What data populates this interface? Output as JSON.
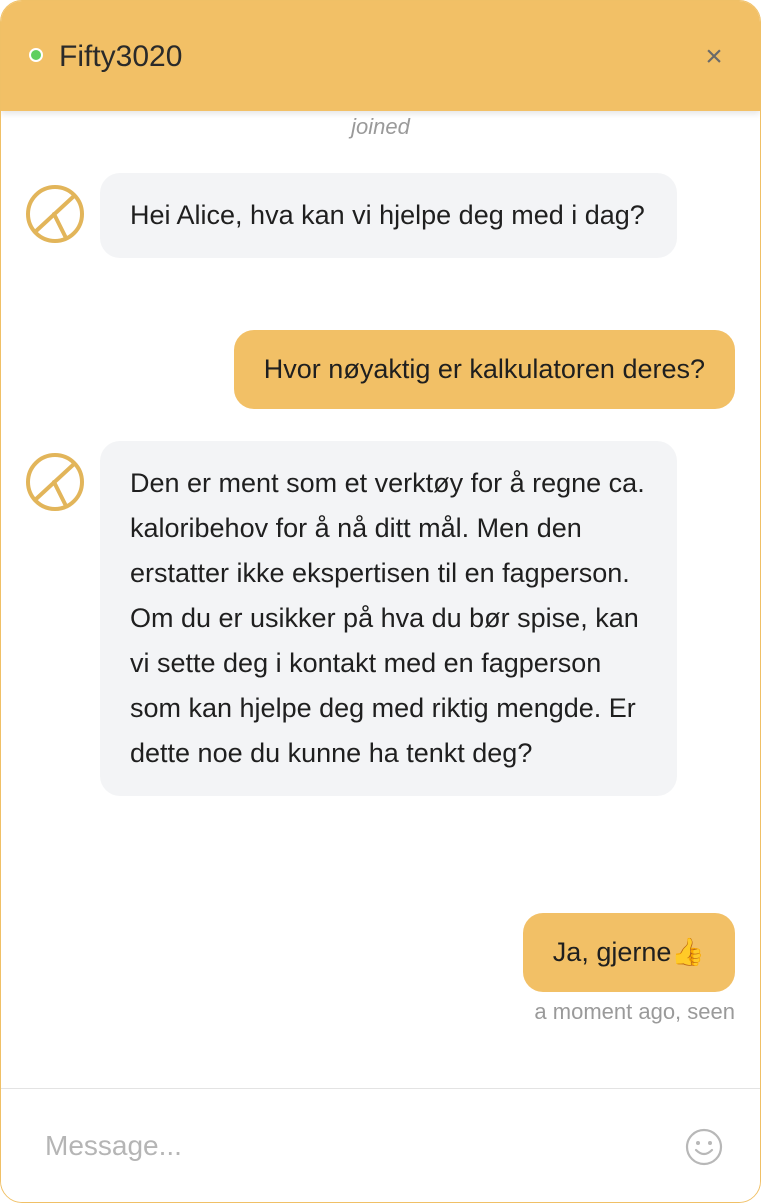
{
  "header": {
    "title": "Fifty3020",
    "close_label": "×",
    "status_color": "#5fcf5f",
    "accent_color": "#f2c066"
  },
  "system": {
    "joined_text": "joined"
  },
  "messages": [
    {
      "sender": "agent",
      "text": "Hei Alice, hva kan vi hjelpe deg med i dag?"
    },
    {
      "sender": "user",
      "text": "Hvor nøyaktig er kalkulatoren deres?"
    },
    {
      "sender": "agent",
      "text": "Den er ment som et verktøy for å regne ca. kaloribehov for å nå ditt mål. Men den erstatter ikke ekspertisen til en fagperson. Om du er usikker på hva du bør spise, kan vi sette deg i kontakt med en fagperson som kan hjelpe deg med riktig mengde. Er dette noe du kunne ha tenkt deg?"
    },
    {
      "sender": "user",
      "text": "Ja, gjerne👍"
    }
  ],
  "last_message_meta": "a moment ago, seen",
  "composer": {
    "placeholder": "Message...",
    "value": "",
    "emoji_icon": "smiley-icon"
  },
  "icons": {
    "agent_avatar": "brand-logo-icon",
    "close": "close-icon"
  }
}
